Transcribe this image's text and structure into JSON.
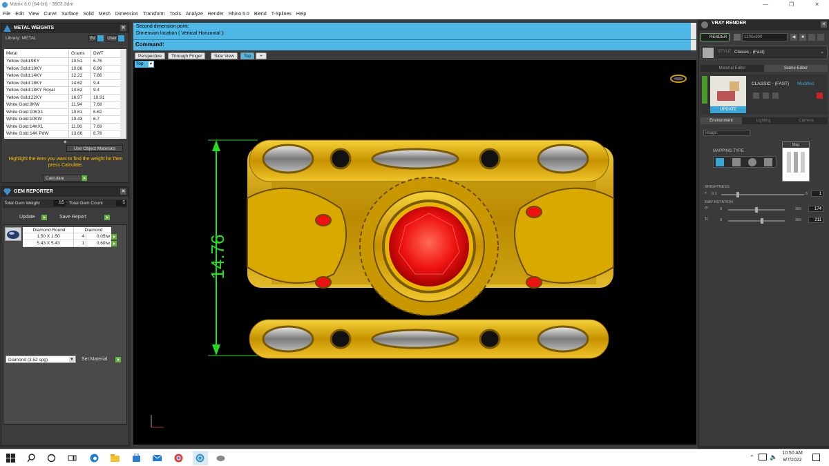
{
  "window": {
    "title": "Matrix 8.0 (64-bit) - 3803.3dm"
  },
  "menu": [
    "File",
    "Edit",
    "View",
    "Curve",
    "Surface",
    "Solid",
    "Mesh",
    "Dimension",
    "Transform",
    "Tools",
    "Analyze",
    "Render",
    "Rhino 5.0",
    "Blend",
    "T-Splines",
    "Help"
  ],
  "metal_weights": {
    "title": "METAL WEIGHTS",
    "library_label": "Library: METAL",
    "btn_0v": "0V",
    "btn_user": "User",
    "columns": [
      "Metal",
      "Grams",
      "DWT"
    ],
    "rows": [
      [
        "Yellow Gold:9KY",
        "10.51",
        "6.76"
      ],
      [
        "Yellow Gold:10KY",
        "10.86",
        "6.99"
      ],
      [
        "Yellow Gold:14KY",
        "12.22",
        "7.86"
      ],
      [
        "Yellow Gold:18KY",
        "14.62",
        "9.4"
      ],
      [
        "Yellow Gold:18KY Royal",
        "14.62",
        "9.4"
      ],
      [
        "Yellow Gold:22KY",
        "16.97",
        "10.91"
      ],
      [
        "White Gold:9KW",
        "11.94",
        "7.68"
      ],
      [
        "White Gold:10KX1",
        "10.61",
        "6.82"
      ],
      [
        "White Gold:10KW",
        "10.43",
        "6.7"
      ],
      [
        "White Gold:14KX1",
        "11.96",
        "7.69"
      ],
      [
        "White Gold:14K PdW",
        "13.66",
        "8.78"
      ]
    ],
    "use_object_materials": "Use Object Materials",
    "instruction": "Highlight the item you want to find the weight for then press Calculate.",
    "calculate": "Calculate"
  },
  "gem_reporter": {
    "title": "GEM REPORTER",
    "total_gem_weight_label": "Total Gem Weight",
    "total_gem_weight": ".65",
    "total_gem_count_label": "Total Gem Count",
    "total_gem_count": "5",
    "update": "Update",
    "save_report": "Save Report",
    "columns": [
      "Diamond Round",
      "Diamond"
    ],
    "rows": [
      [
        "1.50 X 1.50",
        "4",
        "0.05tw"
      ],
      [
        "5.43 X 5.43",
        "1",
        "0.60tw"
      ]
    ],
    "material_select": "Diamond    (3.52 spg)",
    "set_material": "Set Material"
  },
  "command": {
    "line1": "Second dimension point:",
    "line2": "Dimension location ( Vertical  Horizontal ):",
    "prompt": "Command:"
  },
  "viewport_tabs": [
    "Perspective",
    "Through Finger",
    "Side View",
    "Top"
  ],
  "viewport_label": "Top",
  "dimension_value": "14.76",
  "vray": {
    "title": "VRAY RENDER",
    "render_btn": "RENDER",
    "resolution": "1200x900",
    "style_label": "STYLE",
    "style_value": "Classic - (Fast)",
    "tabs": [
      "Material Editor",
      "Scene Editor"
    ],
    "preset_name": "CLASSIC - (FAST)",
    "preset_state": "Modified",
    "update_btn": "UPDATE",
    "env_tabs": [
      "Environment",
      "Lighting",
      "Camera"
    ],
    "env_type": "Image",
    "mapping_type": "MAPPING TYPE",
    "map_label": "Map",
    "brightness_label": "BRIGHTNESS",
    "brightness_min": "0.1",
    "brightness_max": "5",
    "brightness_value": "1",
    "map_rotation_label": "MAP ROTATION",
    "rot1_min": "0",
    "rot1_max": "360",
    "rot1_value": "174",
    "rot2_min": "0",
    "rot2_max": "360",
    "rot2_value": "211"
  },
  "taskbar": {
    "time": "10:50 AM",
    "date": "9/7/2022"
  },
  "colors": {
    "accent_blue": "#4fb8e6",
    "dimension_green": "#22dd22",
    "gold": "#e0b000",
    "ruby": "#ee1111"
  }
}
